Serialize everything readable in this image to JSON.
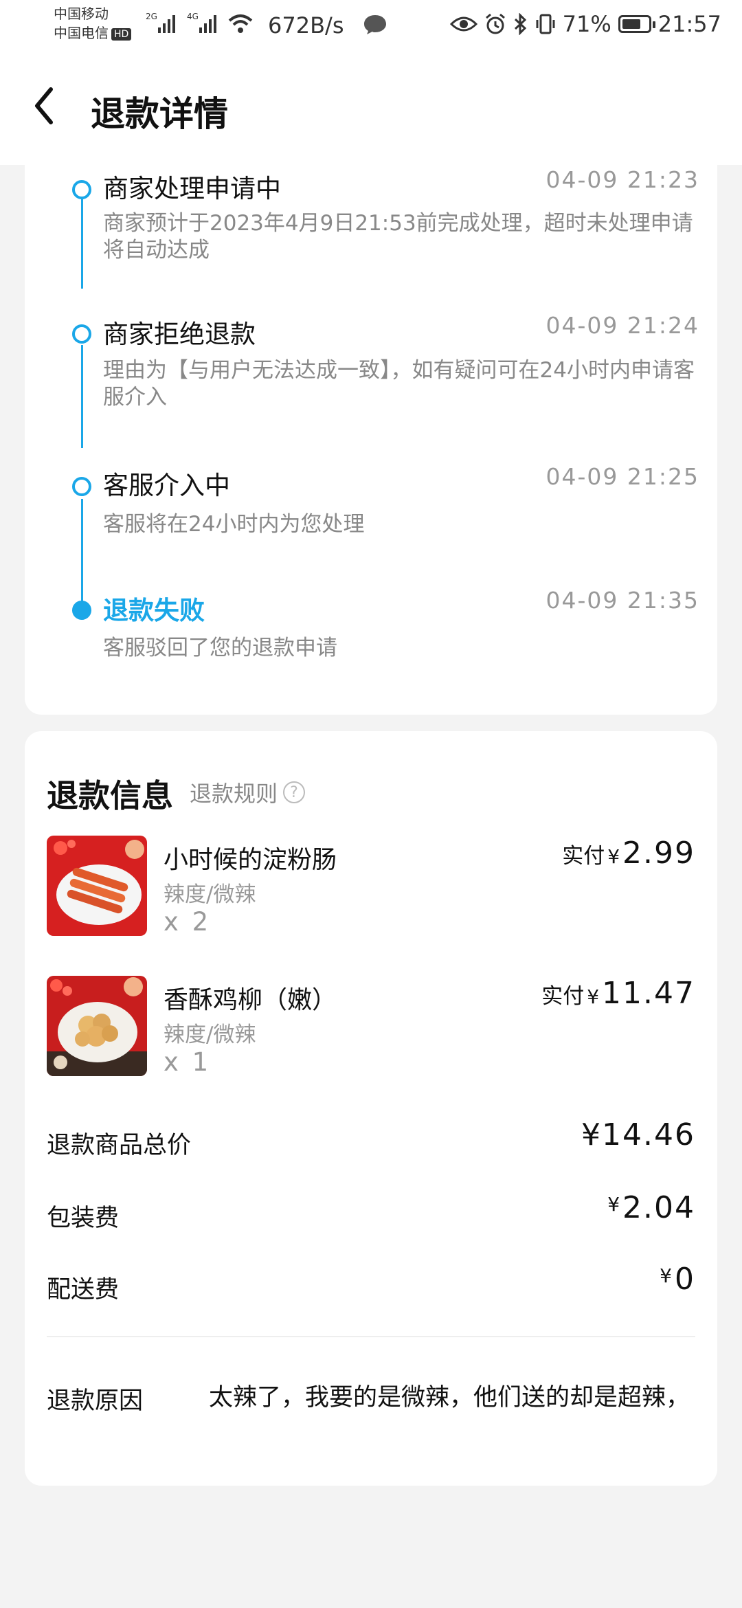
{
  "status_bar": {
    "carrier1": "中国移动",
    "carrier2": "中国电信",
    "hd": "HD",
    "net1": "2G",
    "net2": "4G",
    "speed": "672B/s",
    "battery": "71%",
    "battery_level": 0.71,
    "time": "21:57"
  },
  "header": {
    "title": "退款详情"
  },
  "timeline": [
    {
      "title": "商家处理申请中",
      "time": "04-09  21:23",
      "desc": "商家预计于2023年4月9日21:53前完成处理，超时未处理申请将自动达成",
      "active": false
    },
    {
      "title": "商家拒绝退款",
      "time": "04-09  21:24",
      "desc": "理由为【与用户无法达成一致】，如有疑问可在24小时内申请客服介入",
      "active": false
    },
    {
      "title": "客服介入中",
      "time": "04-09  21:25",
      "desc": "客服将在24小时内为您处理",
      "active": false
    },
    {
      "title": "退款失败",
      "time": "04-09  21:35",
      "desc": "客服驳回了您的退款申请",
      "active": true
    }
  ],
  "refund_info": {
    "title": "退款信息",
    "rule_link": "退款规则",
    "items": [
      {
        "name": "小时候的淀粉肠",
        "spec": "辣度/微辣",
        "qty": "x 2",
        "price_label": "实付",
        "currency": "¥",
        "price": "2.99"
      },
      {
        "name": "香酥鸡柳（嫩）",
        "spec": "辣度/微辣",
        "qty": "x 1",
        "price_label": "实付",
        "currency": "¥",
        "price": "11.47"
      }
    ],
    "fees": [
      {
        "label": "退款商品总价",
        "currency": "¥",
        "value": "14.46"
      },
      {
        "label": "包装费",
        "currency": "¥",
        "value": "2.04"
      },
      {
        "label": "配送费",
        "currency": "¥",
        "value": "0"
      }
    ],
    "reason_label": "退款原因",
    "reason_text": "太辣了，我要的是微辣，他们送的却是超辣，"
  },
  "colors": {
    "accent": "#1aa7e8",
    "background": "#f3f3f3"
  }
}
